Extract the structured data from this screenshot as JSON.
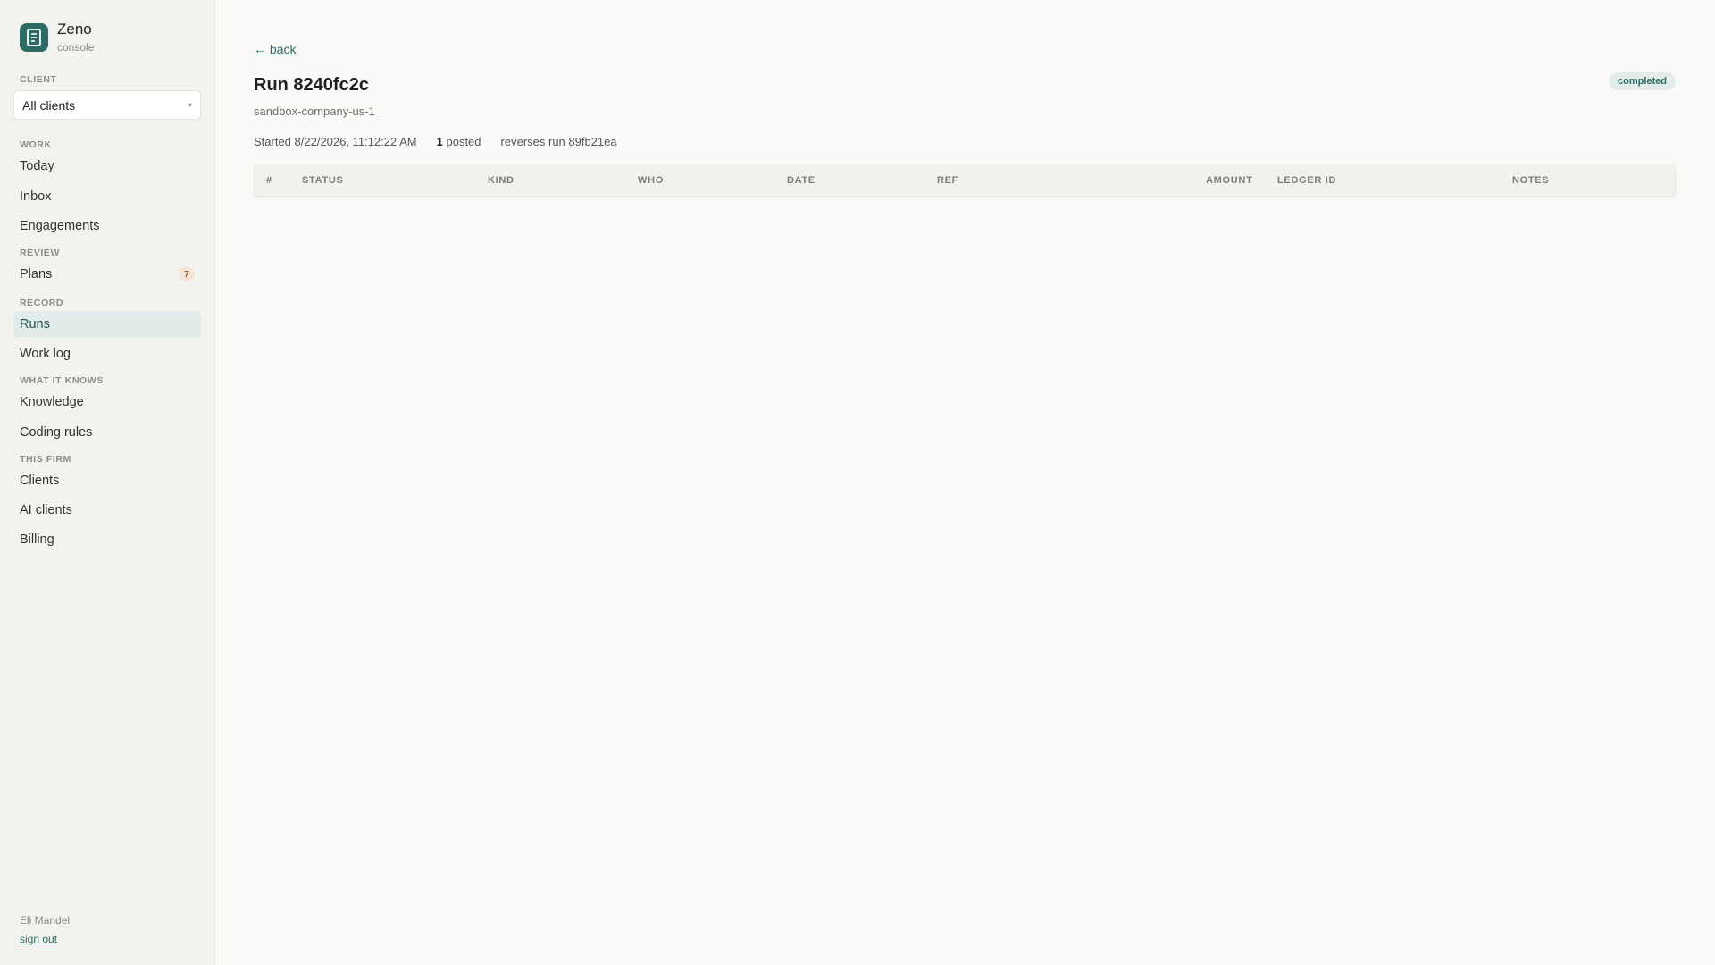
{
  "brand": {
    "name": "Zeno",
    "sub": "console"
  },
  "sidebar": {
    "client_label": "CLIENT",
    "client_select": "All clients",
    "sections": [
      {
        "label": "WORK",
        "items": [
          {
            "label": "Today"
          },
          {
            "label": "Inbox"
          },
          {
            "label": "Engagements"
          }
        ]
      },
      {
        "label": "REVIEW",
        "items": [
          {
            "label": "Plans",
            "badge": "7"
          }
        ]
      },
      {
        "label": "RECORD",
        "items": [
          {
            "label": "Runs",
            "active": true
          },
          {
            "label": "Work log"
          }
        ]
      },
      {
        "label": "WHAT IT KNOWS",
        "items": [
          {
            "label": "Knowledge"
          },
          {
            "label": "Coding rules"
          }
        ]
      },
      {
        "label": "THIS FIRM",
        "items": [
          {
            "label": "Clients"
          },
          {
            "label": "AI clients"
          },
          {
            "label": "Billing"
          }
        ]
      }
    ],
    "user_name": "Eli Mandel",
    "sign_out": "sign out"
  },
  "main": {
    "back": "← back",
    "title": "Run 8240fc2c",
    "subtitle": "sandbox-company-us-1",
    "status": "completed",
    "started": "Started 8/22/2026, 11:12:22 AM",
    "posted_count": "1",
    "posted_label": "posted",
    "reverses": "reverses run 89fb21ea"
  },
  "table": {
    "columns": [
      "#",
      "STATUS",
      "KIND",
      "WHO",
      "DATE",
      "REF",
      "AMOUNT",
      "LEDGER ID",
      "NOTES"
    ]
  },
  "colors": {
    "accent": "#2f6b65",
    "sidebar_bg": "#f2f2ef",
    "main_bg": "#fafaf8"
  }
}
